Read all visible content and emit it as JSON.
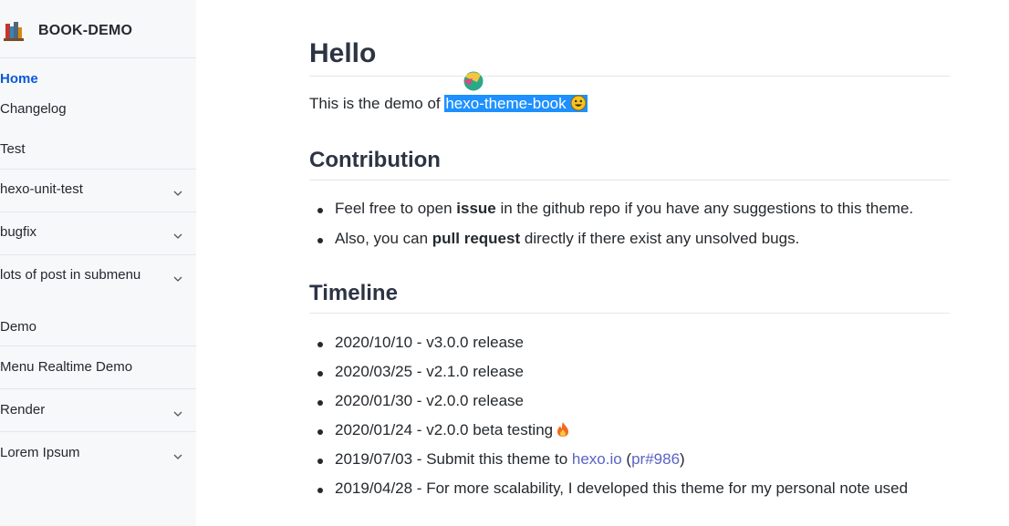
{
  "sidebar": {
    "brand": "BOOK-DEMO",
    "items": [
      {
        "label": "Home",
        "active": true
      },
      {
        "label": "Changelog"
      },
      {
        "label": "Test"
      },
      {
        "label": "hexo-unit-test",
        "has_submenu": true
      },
      {
        "label": "bugfix",
        "has_submenu": true
      },
      {
        "label": "lots of post in submenu",
        "has_submenu": true
      },
      {
        "label": "Demo"
      },
      {
        "label": "Menu Realtime Demo"
      },
      {
        "label": "Render",
        "has_submenu": true
      },
      {
        "label": "Lorem Ipsum",
        "has_submenu": true
      }
    ]
  },
  "content": {
    "title": "Hello",
    "intro_prefix": "This is the demo of ",
    "intro_highlight": "hexo-theme-book",
    "contribution": {
      "heading": "Contribution",
      "items": [
        {
          "a": "Feel free to open ",
          "bold": "issue",
          "b": " in the github repo if you have any suggestions to this theme."
        },
        {
          "a": "Also, you can ",
          "bold": "pull request",
          "b": " directly if there exist any unsolved bugs."
        }
      ]
    },
    "timeline": {
      "heading": "Timeline",
      "items": [
        "2020/10/10 - v3.0.0 release",
        "2020/03/25 - v2.1.0 release",
        "2020/01/30 - v2.0.0 release",
        "2020/01/24 - v2.0.0 beta testing",
        "2019/04/28 - For more scalability, I developed this theme for my personal note used"
      ],
      "submit": {
        "prefix": "2019/07/03 - Submit this theme to ",
        "link": "hexo.io",
        "open": " (",
        "pr": "pr#986",
        "close": ")"
      }
    }
  },
  "colors": {
    "active_menu": "#0a5ad6",
    "highlight_bg": "#1e90ff",
    "link": "#5a63c4"
  }
}
